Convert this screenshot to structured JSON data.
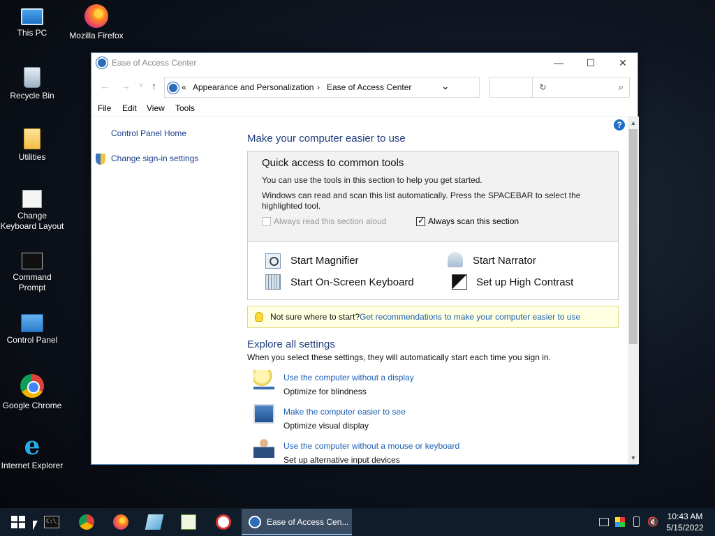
{
  "desktop": {
    "icons": [
      {
        "label": "This PC"
      },
      {
        "label": "Mozilla Firefox"
      },
      {
        "label": "Recycle Bin"
      },
      {
        "label": "Utilities"
      },
      {
        "label": "Change Keyboard Layout"
      },
      {
        "label": "Command Prompt"
      },
      {
        "label": "Control Panel"
      },
      {
        "label": "Google Chrome"
      },
      {
        "label": "Internet Explorer"
      }
    ]
  },
  "window": {
    "title": "Ease of Access Center",
    "controls": {
      "minimize": "—",
      "maximize": "☐",
      "close": "✕"
    },
    "nav": {
      "back": "←",
      "forward": "→",
      "recent": "˅",
      "up": "↑"
    },
    "address": {
      "chevrons": "«",
      "crumb1": "Appearance and Personalization",
      "sep": "›",
      "crumb2": "Ease of Access Center",
      "dropdown": "⌄",
      "refresh": "↻"
    },
    "search": {
      "placeholder": "",
      "icon": "⌕"
    },
    "menu": [
      "File",
      "Edit",
      "View",
      "Tools"
    ],
    "left": {
      "home": "Control Panel Home",
      "signin": "Change sign-in settings"
    },
    "help": "?",
    "main": {
      "heading": "Make your computer easier to use",
      "quick": {
        "heading": "Quick access to common tools",
        "p1": "You can use the tools in this section to help you get started.",
        "p2": "Windows can read and scan this list automatically.  Press the SPACEBAR to select the highlighted tool.",
        "read_aloud": "Always read this section aloud",
        "scan": "Always scan this section",
        "scan_checked": true
      },
      "tools": {
        "magnifier": "Start Magnifier",
        "narrator": "Start Narrator",
        "osk": "Start On-Screen Keyboard",
        "contrast": "Set up High Contrast"
      },
      "tip": {
        "text": "Not sure where to start?",
        "link": "Get recommendations to make your computer easier to use"
      },
      "explore": {
        "heading": "Explore all settings",
        "desc": "When you select these settings, they will automatically start each time you sign in.",
        "items": [
          {
            "link": "Use the computer without a display",
            "sub": "Optimize for blindness"
          },
          {
            "link": "Make the computer easier to see",
            "sub": "Optimize visual display"
          },
          {
            "link": "Use the computer without a mouse or keyboard",
            "sub": "Set up alternative input devices"
          }
        ]
      }
    },
    "scroll": {
      "up": "▲",
      "down": "▼"
    }
  },
  "taskbar": {
    "active_label": "Ease of Access Cen...",
    "cmd_text": "C:\\_",
    "tray": {
      "volume": "🔇"
    },
    "clock": {
      "time": "10:43 AM",
      "date": "5/15/2022"
    }
  }
}
